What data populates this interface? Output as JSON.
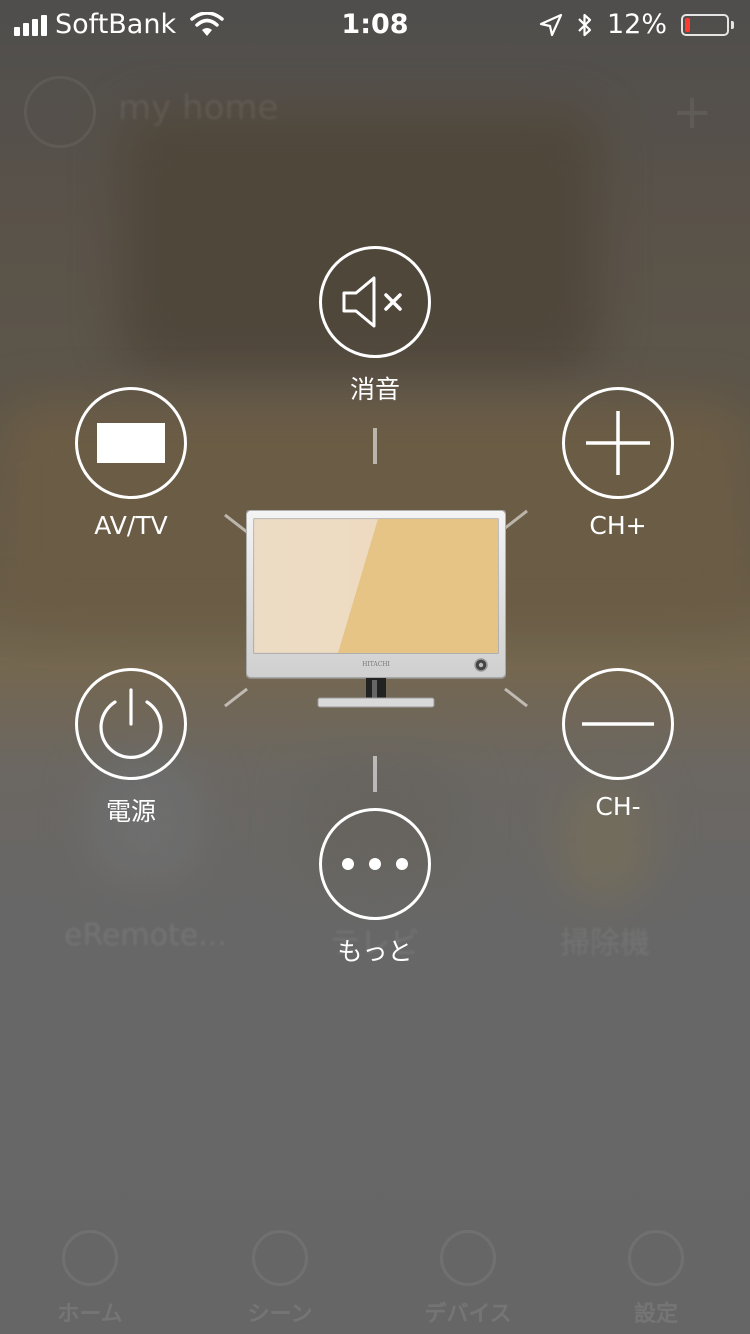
{
  "status_bar": {
    "carrier": "SoftBank",
    "time": "1:08",
    "battery_percent": "12%",
    "battery_level": 0.12,
    "battery_color": "#ff3b30"
  },
  "background_app": {
    "home_title": "my home",
    "devices": [
      "eRemote...",
      "テレビ",
      "掃除機"
    ],
    "tabs": [
      "ホーム",
      "シーン",
      "デバイス",
      "設定"
    ]
  },
  "device": {
    "name": "テレビ",
    "illustration": "tv-icon"
  },
  "actions": {
    "mute": {
      "label": "消音",
      "icon": "mute-icon"
    },
    "input": {
      "label": "AV/TV",
      "icon": "input-source-icon"
    },
    "channel_up": {
      "label": "CH+",
      "icon": "plus-icon"
    },
    "power": {
      "label": "電源",
      "icon": "power-icon"
    },
    "channel_down": {
      "label": "CH-",
      "icon": "minus-icon"
    },
    "more": {
      "label": "もっと",
      "icon": "more-dots-icon"
    }
  }
}
